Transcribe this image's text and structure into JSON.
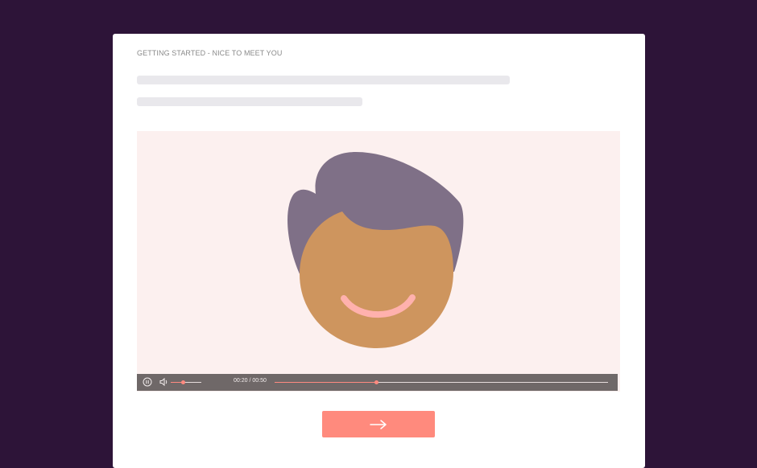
{
  "page": {
    "breadcrumb": "GETTING STARTED - NICE TO MEET YOU"
  },
  "colors": {
    "background": "#2d1438",
    "card": "#ffffff",
    "video_bg": "#fcf0ef",
    "accent": "#ff8a7d",
    "hair": "#7f7087",
    "skin": "#ce955e",
    "smile": "#ffb1ad",
    "controls_bar": "#6f6868"
  },
  "video": {
    "time_display": "00:20 / 00:50",
    "progress_fraction": 0.4,
    "volume_fraction": 0.4,
    "state": "playing",
    "icons": {
      "pause": "pause-icon",
      "volume": "volume-icon"
    }
  },
  "next_button": {
    "icon": "arrow-right-icon"
  }
}
